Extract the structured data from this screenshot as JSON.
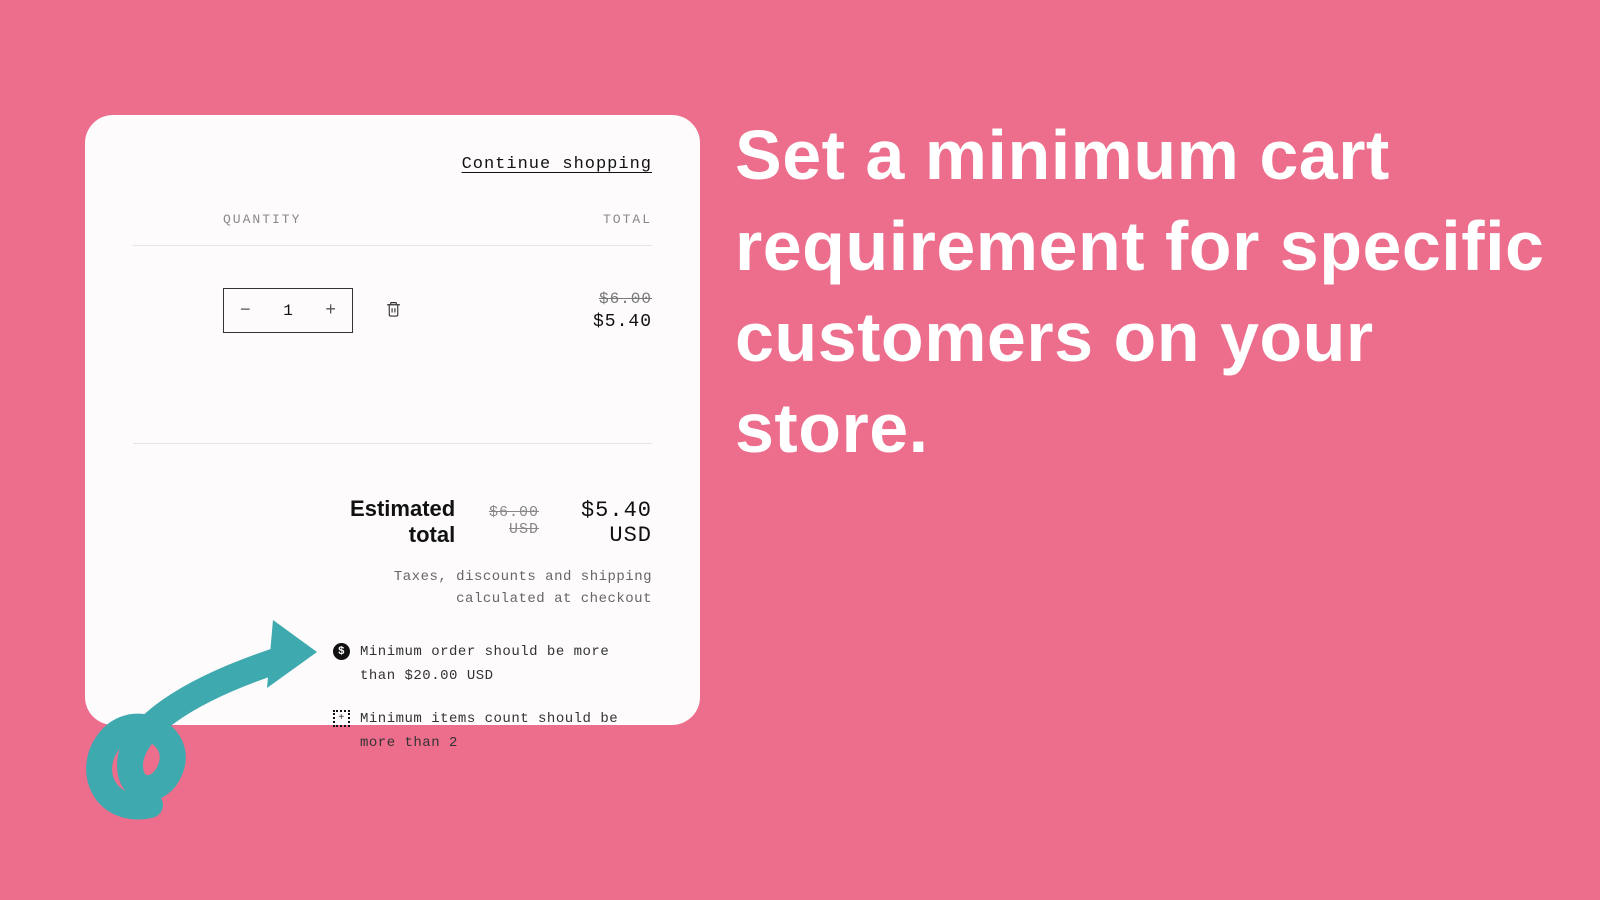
{
  "headline": "Set a minimum cart requirement for specific customers on your store.",
  "cart": {
    "continue_shopping": "Continue shopping",
    "header_quantity": "QUANTITY",
    "header_total": "TOTAL",
    "quantity": "1",
    "line_old_price": "$6.00",
    "line_price": "$5.40",
    "estimated_label": "Estimated total",
    "estimated_old": "$6.00 USD",
    "estimated_new": "$5.40 USD",
    "taxes_note": "Taxes, discounts and shipping calculated at checkout",
    "min_order_msg": "Minimum order should be more than $20.00 USD",
    "min_items_msg": "Minimum items count should be more than 2"
  },
  "colors": {
    "background": "#ed6e8c",
    "arrow": "#3fa9b0"
  }
}
